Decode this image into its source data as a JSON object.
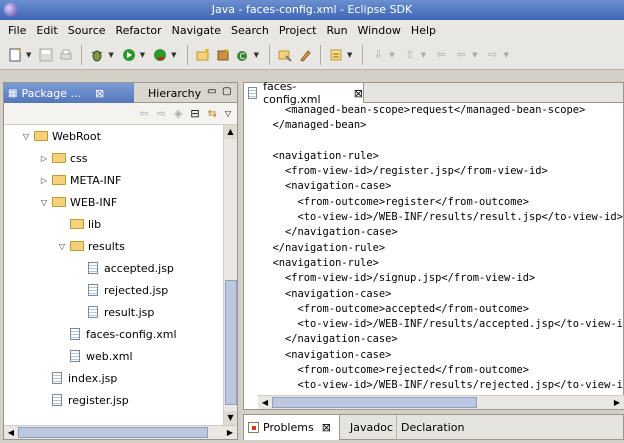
{
  "window": {
    "title": "Java - faces-config.xml - Eclipse SDK"
  },
  "menu": [
    "File",
    "Edit",
    "Source",
    "Refactor",
    "Navigate",
    "Search",
    "Project",
    "Run",
    "Window",
    "Help"
  ],
  "toolbar": {
    "new_icon": "new-wizard-icon",
    "save_icon": "save-icon",
    "print_icon": "print-icon",
    "debug_icon": "debug-icon",
    "run_icon": "run-icon",
    "external_tools_icon": "external-tools-icon",
    "new_java_project_icon": "new-java-project-icon",
    "new_package_icon": "new-package-icon",
    "new_class_icon": "new-class-icon",
    "open_type_icon": "open-type-icon",
    "search_icon": "search-icon",
    "annotation_icon": "annotation-icon",
    "next_annotation_icon": "next-annotation-icon",
    "prev_annotation_icon": "prev-annotation-icon",
    "back_icon": "back-icon",
    "forward_icon": "forward-icon"
  },
  "left_panel": {
    "active_tab": "Package ...",
    "active_tab_close": "⊠",
    "inactive_tab": "Hierarchy",
    "tree": [
      {
        "label": "WebRoot",
        "level": 0,
        "type": "folder",
        "expanded": true
      },
      {
        "label": "css",
        "level": 1,
        "type": "folder",
        "expanded": false
      },
      {
        "label": "META-INF",
        "level": 1,
        "type": "folder",
        "expanded": false
      },
      {
        "label": "WEB-INF",
        "level": 1,
        "type": "folder",
        "expanded": true
      },
      {
        "label": "lib",
        "level": 2,
        "type": "folder",
        "expanded": null
      },
      {
        "label": "results",
        "level": 2,
        "type": "folder",
        "expanded": true
      },
      {
        "label": "accepted.jsp",
        "level": 3,
        "type": "file"
      },
      {
        "label": "rejected.jsp",
        "level": 3,
        "type": "file"
      },
      {
        "label": "result.jsp",
        "level": 3,
        "type": "file"
      },
      {
        "label": "faces-config.xml",
        "level": 2,
        "type": "file"
      },
      {
        "label": "web.xml",
        "level": 2,
        "type": "file"
      },
      {
        "label": "index.jsp",
        "level": 1,
        "type": "file"
      },
      {
        "label": "register.jsp",
        "level": 1,
        "type": "file"
      }
    ]
  },
  "editor": {
    "tab_label": "faces-config.xml",
    "tab_close": "⊠",
    "lines": [
      "    <managed-bean-scope>request</managed-bean-scope>",
      "  </managed-bean>",
      "",
      "  <navigation-rule>",
      "    <from-view-id>/register.jsp</from-view-id>",
      "    <navigation-case>",
      "      <from-outcome>register</from-outcome>",
      "      <to-view-id>/WEB-INF/results/result.jsp</to-view-id>",
      "    </navigation-case>",
      "  </navigation-rule>",
      "  <navigation-rule>",
      "    <from-view-id>/signup.jsp</from-view-id>",
      "    <navigation-case>",
      "      <from-outcome>accepted</from-outcome>",
      "      <to-view-id>/WEB-INF/results/accepted.jsp</to-view-id>",
      "    </navigation-case>",
      "    <navigation-case>",
      "      <from-outcome>rejected</from-outcome>",
      "      <to-view-id>/WEB-INF/results/rejected.jsp</to-view-id>",
      "    </navigation-case>"
    ]
  },
  "bottom_panel": {
    "tabs": [
      "Problems",
      "Javadoc",
      "Declaration"
    ],
    "problems_close": "⊠"
  }
}
